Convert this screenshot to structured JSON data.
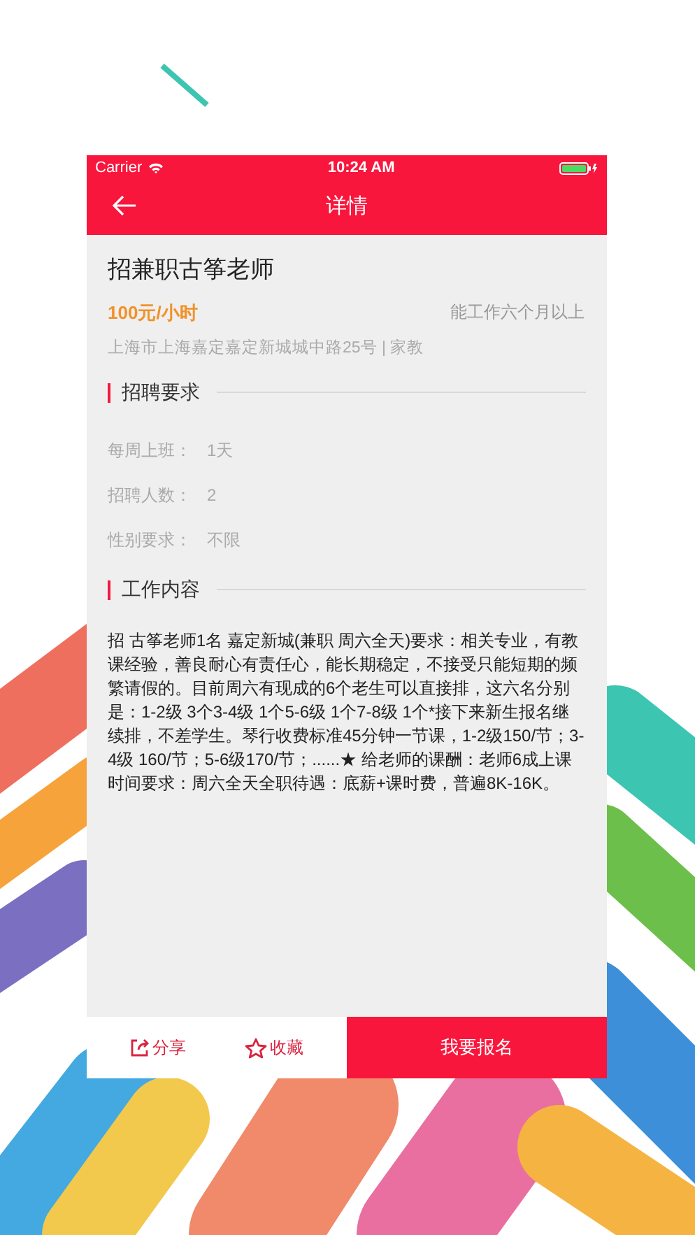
{
  "status_bar": {
    "carrier": "Carrier",
    "time": "10:24 AM"
  },
  "nav": {
    "title": "详情"
  },
  "job": {
    "title": "招兼职古筝老师",
    "salary": "100元/小时",
    "duration": "能工作六个月以上",
    "location": "上海市上海嘉定嘉定新城城中路25号 | 家教"
  },
  "requirements": {
    "heading": "招聘要求",
    "rows": [
      {
        "label": "每周上班：",
        "value": "1天"
      },
      {
        "label": "招聘人数：",
        "value": "2"
      },
      {
        "label": "性别要求：",
        "value": "不限"
      }
    ]
  },
  "content": {
    "heading": "工作内容",
    "text": "招 古筝老师1名 嘉定新城(兼职 周六全天)要求：相关专业，有教课经验，善良耐心有责任心，能长期稳定，不接受只能短期的频繁请假的。目前周六有现成的6个老生可以直接排，这六名分别是：1-2级 3个3-4级 1个5-6级 1个7-8级 1个*接下来新生报名继续排，不差学生。琴行收费标准45分钟一节课，1-2级150/节；3-4级 160/节；5-6级170/节；......★ 给老师的课酬：老师6成上课时间要求：周六全天全职待遇：底薪+课时费，普遍8K-16K。"
  },
  "bottom_bar": {
    "share": "分享",
    "favorite": "收藏",
    "apply": "我要报名"
  }
}
